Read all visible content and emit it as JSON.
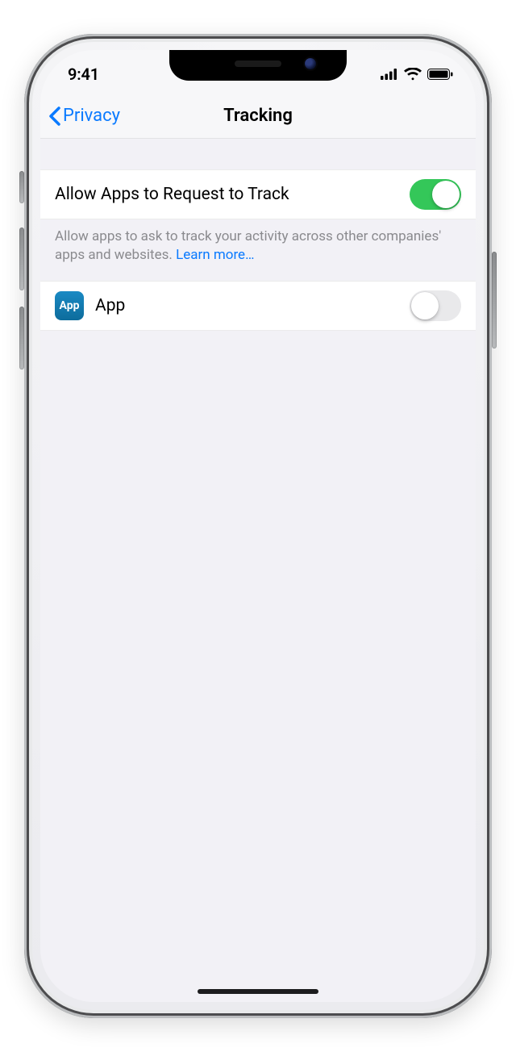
{
  "status": {
    "time": "9:41"
  },
  "nav": {
    "back": "Privacy",
    "title": "Tracking"
  },
  "allowRow": {
    "label": "Allow Apps to Request to Track",
    "on": true
  },
  "footer": {
    "text": "Allow apps to ask to track your activity across other companies' apps and websites. ",
    "link": "Learn more…"
  },
  "appRow": {
    "iconText": "App",
    "label": "App",
    "on": false
  }
}
